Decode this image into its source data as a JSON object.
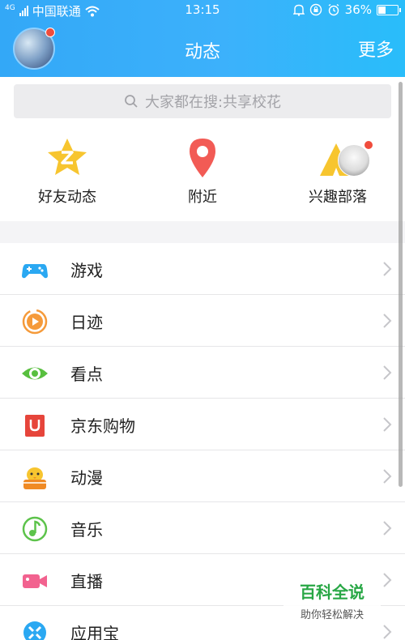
{
  "status_bar": {
    "network": "4G",
    "carrier": "中国联通",
    "time": "13:15",
    "battery_pct": "36%"
  },
  "header": {
    "title": "动态",
    "more_label": "更多"
  },
  "search": {
    "placeholder": "大家都在搜:共享校花"
  },
  "quick_entries": [
    {
      "label": "好友动态",
      "icon": "star-z-icon",
      "color": "#f7c52f"
    },
    {
      "label": "附近",
      "icon": "location-pin-icon",
      "color": "#f25b55"
    },
    {
      "label": "兴趣部落",
      "icon": "tribe-tent-icon",
      "color": "#f7c52f"
    }
  ],
  "menu_items": [
    {
      "label": "游戏",
      "icon": "gamepad-icon",
      "color": "#2aa8f2"
    },
    {
      "label": "日迹",
      "icon": "video-play-icon",
      "color": "#f59a3a"
    },
    {
      "label": "看点",
      "icon": "eye-icon",
      "color": "#58bf3f"
    },
    {
      "label": "京东购物",
      "icon": "shopping-bag-icon",
      "color": "#e6453b"
    },
    {
      "label": "动漫",
      "icon": "cartoon-chick-icon",
      "color": "#f7c52f"
    },
    {
      "label": "音乐",
      "icon": "music-note-icon",
      "color": "#5dc34b"
    },
    {
      "label": "直播",
      "icon": "live-camera-icon",
      "color": "#f2628f"
    },
    {
      "label": "应用宝",
      "icon": "app-store-icon",
      "color": "#2aa8f2"
    }
  ],
  "watermark": {
    "title": "百科全说",
    "subtitle": "助你轻松解决"
  }
}
